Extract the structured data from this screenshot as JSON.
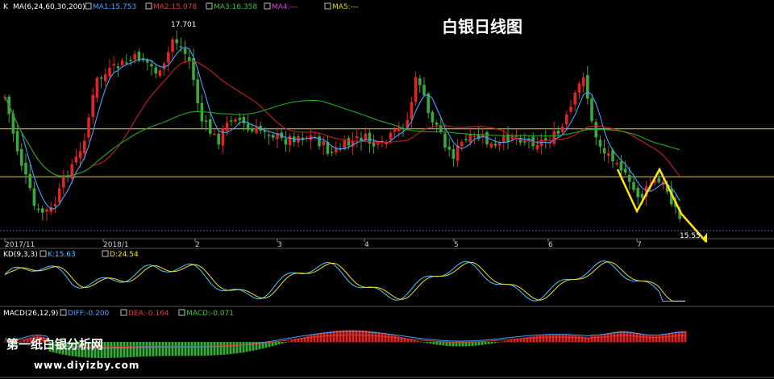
{
  "title": "白银日线图",
  "colors": {
    "up": "#e02424",
    "down": "#3aa83a",
    "ma1": "#4aa3ff",
    "ma2": "#c81e1e",
    "ma3": "#22a822",
    "kline": "#4fc8ff",
    "dline": "#f0e030",
    "diff": "#4aa3ff",
    "dea": "#e23b3b",
    "level": "#e6d21e",
    "pattern": "#ffe21a"
  },
  "main_header": {
    "k": "K",
    "ma": "MA(6,24,60,30,200)",
    "ma1": "MA1:15.753",
    "ma2": "MA2:15.078",
    "ma3": "MA3:16.358",
    "ma4": "MA4:---",
    "ma5": "MA5:---"
  },
  "kd_header": {
    "name": "KD(9,3,3)",
    "k": "K:15.63",
    "d": "D:24.54"
  },
  "macd_header": {
    "name": "MACD(26,12,9)",
    "diff": "DIFF:-0.200",
    "dea": "DEA:-0.164",
    "macd": "MACD:-0.071"
  },
  "annotations": {
    "high": "17.701",
    "last": "15.55"
  },
  "watermark": {
    "cn": "第一纸白银分析网",
    "url": "www.diyizby.com"
  },
  "chart_data": {
    "type": "candlestick",
    "title": "白银日线图",
    "x_ticks": [
      "2017/11",
      "2018/1",
      "2",
      "3",
      "4",
      "5",
      "6",
      "7"
    ],
    "ylim": [
      15.4,
      17.85
    ],
    "levels": [
      16.6,
      16.06
    ],
    "pattern": "W",
    "annotations": {
      "high": 17.701,
      "last": 15.55
    },
    "kd": {
      "k": 15.63,
      "d": 24.54,
      "params": [
        9,
        3,
        3
      ]
    },
    "macd": {
      "diff": -0.2,
      "dea": -0.164,
      "macd": -0.071,
      "params": [
        26,
        12,
        9
      ]
    },
    "ma": {
      "params": [
        6,
        24,
        60,
        30,
        200
      ],
      "ma1": 15.753,
      "ma2": 15.078,
      "ma3": 16.358
    }
  }
}
